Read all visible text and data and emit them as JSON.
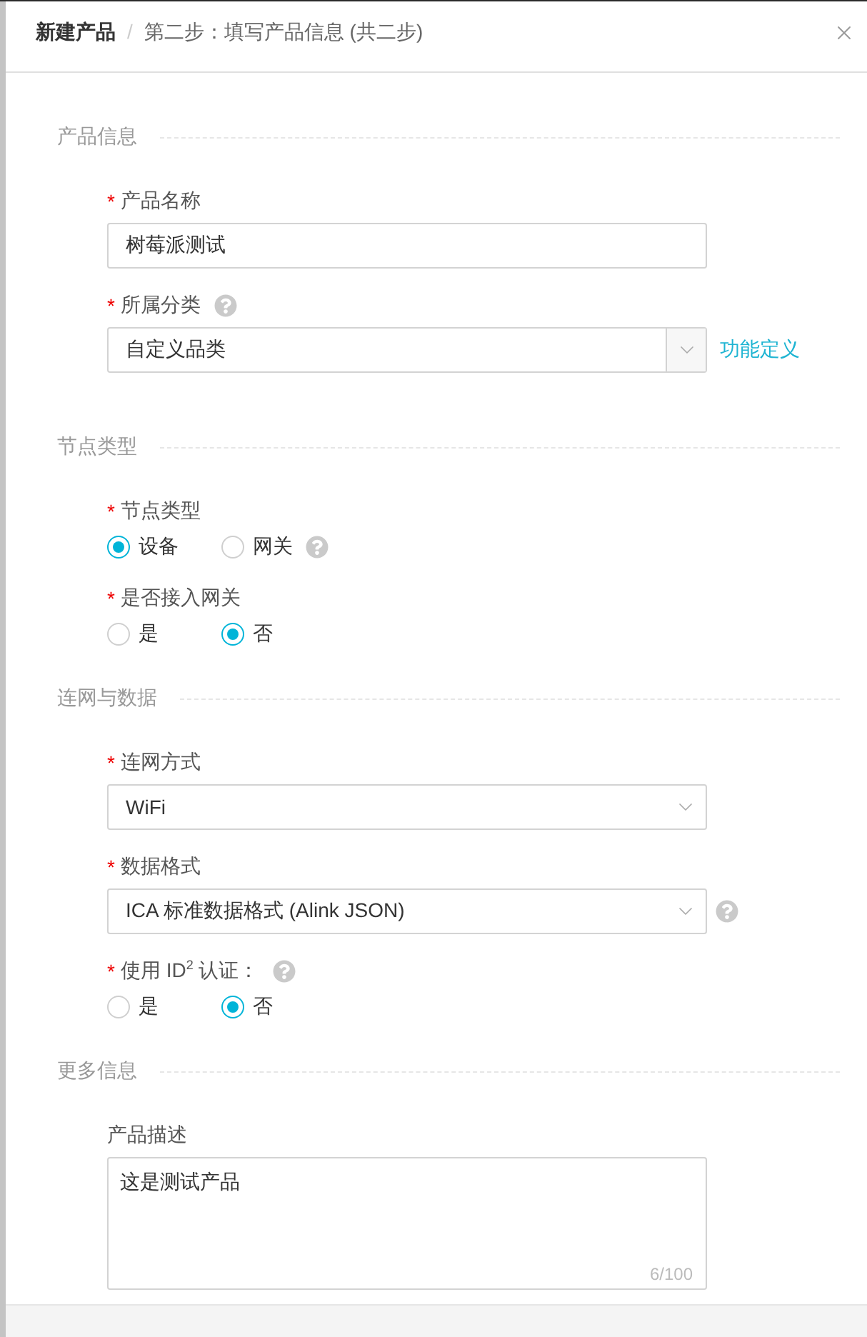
{
  "header": {
    "title": "新建产品",
    "separator": "/",
    "step": "第二步：填写产品信息 (共二步)"
  },
  "sections": [
    {
      "title": "产品信息",
      "fields": [
        {
          "kind": "input",
          "required_mark": "*",
          "label": "产品名称",
          "value": "树莓派测试"
        },
        {
          "kind": "select",
          "required_mark": "*",
          "label": "所属分类",
          "help_on_label": true,
          "value": "自定义品类",
          "arrow_box": true,
          "link": "功能定义"
        }
      ]
    },
    {
      "title": "节点类型",
      "fields": [
        {
          "kind": "radio",
          "required_mark": "*",
          "label": "节点类型",
          "help_on_options": true,
          "options": [
            {
              "label": "设备",
              "selected": true
            },
            {
              "label": "网关",
              "selected": false
            }
          ]
        },
        {
          "kind": "radio",
          "required_mark": "*",
          "label": "是否接入网关",
          "options": [
            {
              "label": "是",
              "selected": false
            },
            {
              "label": "否",
              "selected": true
            }
          ]
        }
      ]
    },
    {
      "title": "连网与数据",
      "fields": [
        {
          "kind": "select",
          "required_mark": "*",
          "label": "连网方式",
          "value": "WiFi",
          "arrow_box": false
        },
        {
          "kind": "select",
          "required_mark": "*",
          "label": "数据格式",
          "help_on_control": true,
          "value": "ICA 标准数据格式 (Alink JSON)",
          "arrow_box": false
        },
        {
          "kind": "radio",
          "required_mark": "*",
          "label": "使用 ID$^{2}$ 认证：",
          "help_on_label": true,
          "options": [
            {
              "label": "是",
              "selected": false
            },
            {
              "label": "否",
              "selected": true
            }
          ]
        }
      ]
    },
    {
      "title": "更多信息",
      "fields": [
        {
          "kind": "textarea",
          "label": "产品描述",
          "value": "这是测试产品",
          "counter": "6/100"
        }
      ]
    }
  ]
}
